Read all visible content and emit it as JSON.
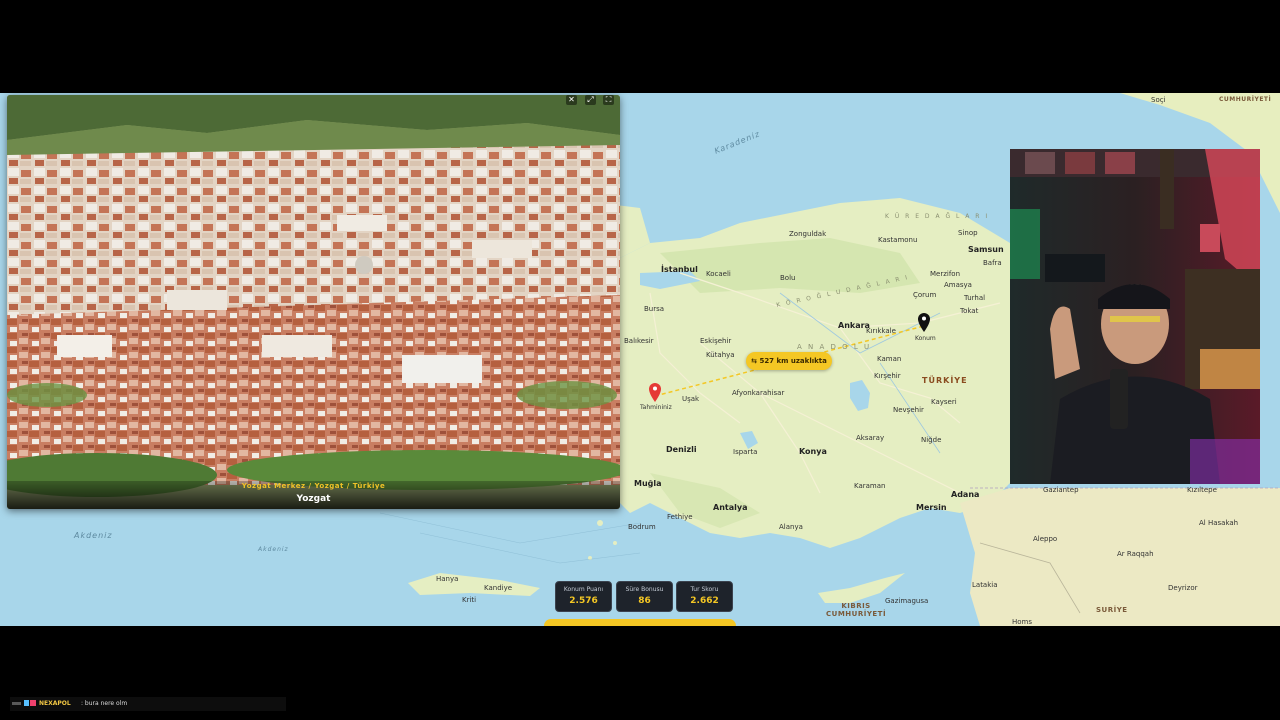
{
  "photo": {
    "location_path": "Yozgat Merkez / Yozgat / Türkiye",
    "location_name": "Yozgat",
    "controls": [
      "close-icon",
      "pin-icon",
      "fullscreen-icon"
    ]
  },
  "map": {
    "distance_label": "⇆ 527 km uzaklıkta",
    "guess_marker_label": "Tahmininiz",
    "actual_marker_label": "Konum",
    "labels": {
      "black_sea": "Karadeniz",
      "mediterranean": "Akdeniz",
      "turkey": "TÜRKİYE",
      "anadolu": "A N A D O L U",
      "koroglu": "K Ö R O Ğ L U   D A Ğ L A R I",
      "kure": "K Ü R E   D A Ğ L A R I",
      "istanbul": "İstanbul",
      "kocaeli": "Kocaeli",
      "ankara": "Ankara",
      "bursa": "Bursa",
      "eskisehir": "Eskişehir",
      "kutahya": "Kütahya",
      "usak": "Uşak",
      "afyon": "Afyonkarahisar",
      "konya": "Konya",
      "kayseri": "Kayseri",
      "kaman": "Kaman",
      "kirsehir": "Kırşehir",
      "kirikkale": "Kırıkkale",
      "nevsehir": "Nevşehir",
      "aksaray": "Aksaray",
      "nigde": "Niğde",
      "karaman": "Karaman",
      "mersin": "Mersin",
      "adana": "Adana",
      "antalya": "Antalya",
      "isparta": "Isparta",
      "denizli": "Denizli",
      "mugla": "Muğla",
      "fethiye": "Fethiye",
      "alanya": "Alanya",
      "bodrum": "Bodrum",
      "balikesir": "Balıkesir",
      "samsun": "Samsun",
      "amasya": "Amasya",
      "tokat": "Tokat",
      "corum": "Çorum",
      "kastamonu": "Kastamonu",
      "zonguldak": "Zonguldak",
      "bolu": "Bolu",
      "sinop": "Sinop",
      "merzifon": "Merzifon",
      "turhal": "Turhal",
      "bafra": "Bafra",
      "gaziantep": "Gaziantep",
      "kizıltepe": "Kızıltepe",
      "al_hasakah": "Al Hasakah",
      "aleppo": "Aleppo",
      "ar_raqqah": "Ar Raqqah",
      "deyrizor": "Deyrizor",
      "homs": "Homs",
      "latakia": "Latakia",
      "suriye": "SURİYE",
      "kibris": "KIBRIS\nCUMHURİYETİ",
      "girne": "Gazimagusa",
      "kriti": "Kriti",
      "hanya": "Hanya",
      "kandiye": "Kandiye",
      "soci": "Soçi",
      "cumhuriyeti": "CUMHURİYETİ",
      "antakya": "Akdeniz"
    }
  },
  "scores": [
    {
      "label": "Konum Puanı",
      "value": "2.576"
    },
    {
      "label": "Süre Bonusu",
      "value": "86"
    },
    {
      "label": "Tur Skoru",
      "value": "2.662"
    }
  ],
  "chat": {
    "username": "NEXAPOL",
    "message": ": bura nere olm"
  },
  "colors": {
    "accent": "#f4c724",
    "sea": "#a8d6ea",
    "land": "#e5eec2",
    "guess_marker": "#e53935",
    "actual_marker": "#111111"
  }
}
